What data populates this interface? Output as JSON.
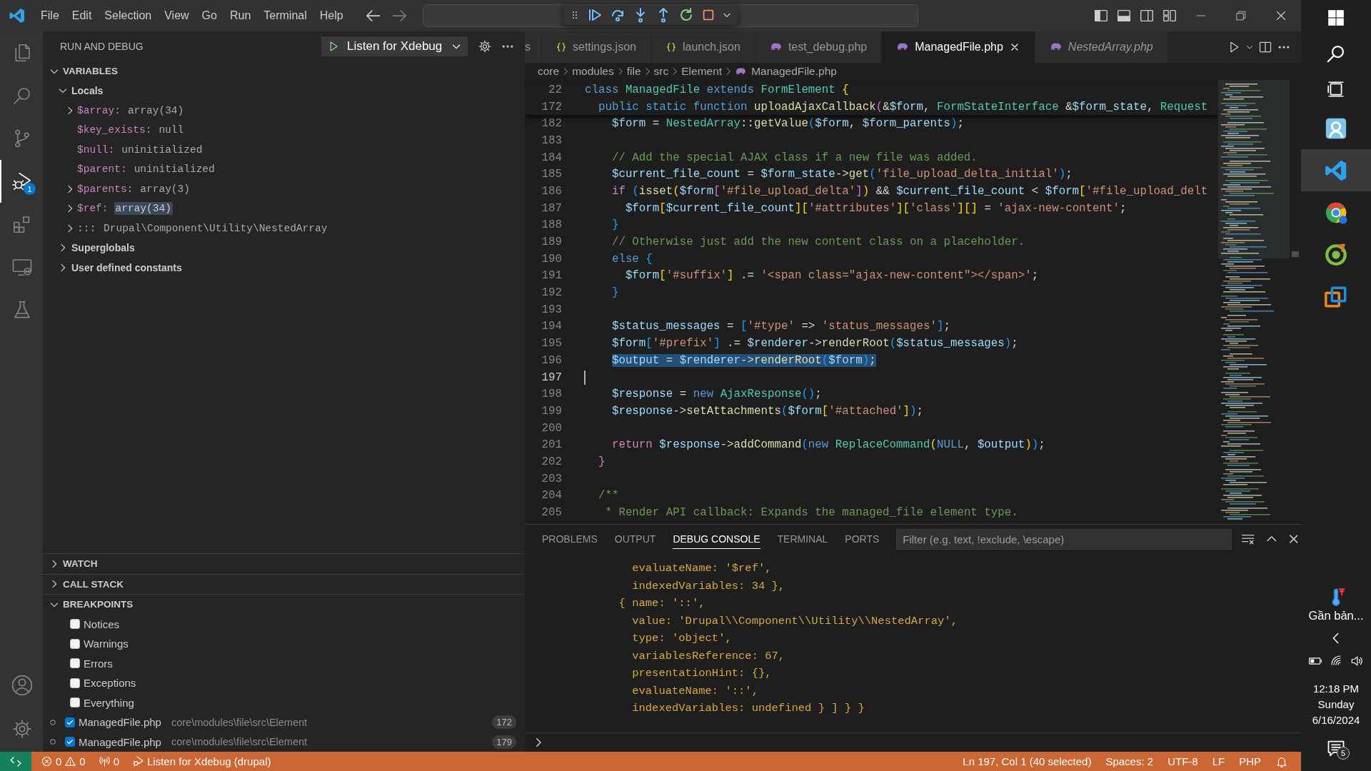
{
  "title_bar": {
    "menu": [
      "File",
      "Edit",
      "Selection",
      "View",
      "Go",
      "Run",
      "Terminal",
      "Help"
    ]
  },
  "activity_bar": {
    "items": [
      {
        "selected": false
      },
      {
        "selected": false
      },
      {
        "selected": false
      },
      {
        "selected": true,
        "badge": "1"
      },
      {
        "selected": false
      },
      {
        "selected": false
      },
      {
        "selected": false
      }
    ]
  },
  "sidebar": {
    "title": "RUN AND DEBUG",
    "config": "Listen for Xdebug",
    "variables": {
      "label": "VARIABLES",
      "expanded": true,
      "scopes": [
        {
          "label": "Locals",
          "expanded": true,
          "children": [
            {
              "name": "$array:",
              "value": "array(34)",
              "kind": "variable",
              "expandable": true,
              "highlighted": false
            },
            {
              "name": "$key_exists:",
              "value": "null",
              "kind": "variable",
              "expandable": false,
              "highlighted": false
            },
            {
              "name": "$null:",
              "value": "uninitialized",
              "kind": "variable",
              "expandable": false,
              "highlighted": false
            },
            {
              "name": "$parent:",
              "value": "uninitialized",
              "kind": "variable",
              "expandable": false,
              "highlighted": false
            },
            {
              "name": "$parents:",
              "value": "array(3)",
              "kind": "variable",
              "expandable": true,
              "highlighted": false
            },
            {
              "name": "$ref:",
              "value": "array(34)",
              "kind": "variable",
              "expandable": true,
              "highlighted": true
            },
            {
              "name": ":::",
              "value": "Drupal\\Component\\Utility\\NestedArray",
              "kind": "class",
              "expandable": true,
              "highlighted": false
            }
          ]
        },
        {
          "label": "Superglobals",
          "expanded": false
        },
        {
          "label": "User defined constants",
          "expanded": false
        }
      ]
    },
    "watch": {
      "label": "WATCH",
      "expanded": false
    },
    "call_stack": {
      "label": "CALL STACK",
      "expanded": false
    },
    "breakpoints": {
      "label": "BREAKPOINTS",
      "expanded": true,
      "items": [
        {
          "kind": "filter",
          "label": "Notices",
          "checked": false
        },
        {
          "kind": "filter",
          "label": "Warnings",
          "checked": false
        },
        {
          "kind": "filter",
          "label": "Errors",
          "checked": false
        },
        {
          "kind": "filter",
          "label": "Exceptions",
          "checked": false
        },
        {
          "kind": "filter",
          "label": "Everything",
          "checked": false
        },
        {
          "kind": "file",
          "label": "ManagedFile.php",
          "path": "core\\modules\\file\\src\\Element",
          "line": "172",
          "checked": true
        },
        {
          "kind": "file",
          "label": "ManagedFile.php",
          "path": "core\\modules\\file\\src\\Element",
          "line": "179",
          "checked": true
        }
      ]
    }
  },
  "editor": {
    "tabs": [
      {
        "label": "s",
        "selected": false,
        "preview": false
      },
      {
        "label": "settings.json",
        "kind": "json",
        "selected": false,
        "preview": false
      },
      {
        "label": "launch.json",
        "kind": "json",
        "selected": false,
        "preview": false
      },
      {
        "label": "test_debug.php",
        "kind": "php",
        "selected": false,
        "preview": false
      },
      {
        "label": "ManagedFile.php",
        "kind": "php",
        "selected": true,
        "preview": false
      },
      {
        "label": "NestedArray.php",
        "kind": "php",
        "selected": false,
        "preview": true
      }
    ],
    "breadcrumb": [
      "core",
      "modules",
      "file",
      "src",
      "Element",
      "ManagedFile.php"
    ],
    "sticky_lines": [
      {
        "number": "22",
        "tokens": [
          {
            "text": "class ",
            "kind": "keyword"
          },
          {
            "text": "ManagedFile ",
            "kind": "type"
          },
          {
            "text": "extends ",
            "kind": "keyword"
          },
          {
            "text": "FormElement ",
            "kind": "type"
          },
          {
            "text": "{",
            "kind": "bracket1"
          }
        ]
      },
      {
        "number": "172",
        "tokens": [
          {
            "text": "  public static function ",
            "kind": "keyword"
          },
          {
            "text": "uploadAjaxCallback",
            "kind": "function"
          },
          {
            "text": "(",
            "kind": "bracket2"
          },
          {
            "text": "&",
            "kind": "operator"
          },
          {
            "text": "$form",
            "kind": "variable"
          },
          {
            "text": ", ",
            "kind": "operator"
          },
          {
            "text": "FormStateInterface ",
            "kind": "type"
          },
          {
            "text": "&",
            "kind": "operator"
          },
          {
            "text": "$form_state",
            "kind": "variable"
          },
          {
            "text": ", ",
            "kind": "operator"
          },
          {
            "text": "Request",
            "kind": "type"
          }
        ]
      }
    ],
    "lines": [
      {
        "number": "182",
        "selected": false,
        "cursor": false,
        "tokens": [
          {
            "text": "    $form",
            "kind": "variable"
          },
          {
            "text": " = ",
            "kind": "operator"
          },
          {
            "text": "NestedArray",
            "kind": "type"
          },
          {
            "text": "::",
            "kind": "operator"
          },
          {
            "text": "getValue",
            "kind": "function"
          },
          {
            "text": "(",
            "kind": "bracket3"
          },
          {
            "text": "$form",
            "kind": "variable"
          },
          {
            "text": ", ",
            "kind": "operator"
          },
          {
            "text": "$form_parents",
            "kind": "variable"
          },
          {
            "text": ")",
            "kind": "bracket3"
          },
          {
            "text": ";",
            "kind": "operator"
          }
        ]
      },
      {
        "number": "183",
        "selected": false,
        "cursor": false
      },
      {
        "number": "184",
        "selected": false,
        "cursor": false,
        "tokens": [
          {
            "text": "    // Add the special AJAX class if a new file was added.",
            "kind": "comment"
          }
        ]
      },
      {
        "number": "185",
        "selected": false,
        "cursor": false,
        "tokens": [
          {
            "text": "    $current_file_count",
            "kind": "variable"
          },
          {
            "text": " = ",
            "kind": "operator"
          },
          {
            "text": "$form_state",
            "kind": "variable"
          },
          {
            "text": "->",
            "kind": "operator"
          },
          {
            "text": "get",
            "kind": "function"
          },
          {
            "text": "(",
            "kind": "bracket3"
          },
          {
            "text": "'file_upload_delta_initial'",
            "kind": "string"
          },
          {
            "text": ")",
            "kind": "bracket3"
          },
          {
            "text": ";",
            "kind": "operator"
          }
        ]
      },
      {
        "number": "186",
        "selected": false,
        "cursor": false,
        "tokens": [
          {
            "text": "    if ",
            "kind": "control"
          },
          {
            "text": "(",
            "kind": "bracket3"
          },
          {
            "text": "isset",
            "kind": "function"
          },
          {
            "text": "(",
            "kind": "bracket1"
          },
          {
            "text": "$form",
            "kind": "variable"
          },
          {
            "text": "[",
            "kind": "bracket2"
          },
          {
            "text": "'#file_upload_delta'",
            "kind": "string"
          },
          {
            "text": "]",
            "kind": "bracket2"
          },
          {
            "text": ")",
            "kind": "bracket1"
          },
          {
            "text": " && ",
            "kind": "operator"
          },
          {
            "text": "$current_file_count",
            "kind": "variable"
          },
          {
            "text": " < ",
            "kind": "operator"
          },
          {
            "text": "$form",
            "kind": "variable"
          },
          {
            "text": "[",
            "kind": "bracket1"
          },
          {
            "text": "'#file_upload_delt",
            "kind": "string"
          }
        ]
      },
      {
        "number": "187",
        "selected": false,
        "cursor": false,
        "tokens": [
          {
            "text": "      $form",
            "kind": "variable"
          },
          {
            "text": "[",
            "kind": "bracket1"
          },
          {
            "text": "$current_file_count",
            "kind": "variable"
          },
          {
            "text": "][",
            "kind": "bracket1"
          },
          {
            "text": "'#attributes'",
            "kind": "string"
          },
          {
            "text": "][",
            "kind": "bracket1"
          },
          {
            "text": "'class'",
            "kind": "string"
          },
          {
            "text": "][]",
            "kind": "bracket1"
          },
          {
            "text": " = ",
            "kind": "operator"
          },
          {
            "text": "'ajax-new-content'",
            "kind": "string"
          },
          {
            "text": ";",
            "kind": "operator"
          }
        ]
      },
      {
        "number": "188",
        "selected": false,
        "cursor": false,
        "tokens": [
          {
            "text": "    }",
            "kind": "bracket3"
          }
        ]
      },
      {
        "number": "189",
        "selected": false,
        "cursor": false,
        "tokens": [
          {
            "text": "    // Otherwise just add the new content class on a placeholder.",
            "kind": "comment"
          }
        ]
      },
      {
        "number": "190",
        "selected": false,
        "cursor": false,
        "tokens": [
          {
            "text": "    else ",
            "kind": "keyword"
          },
          {
            "text": "{",
            "kind": "bracket3"
          }
        ]
      },
      {
        "number": "191",
        "selected": false,
        "cursor": false,
        "tokens": [
          {
            "text": "      $form",
            "kind": "variable"
          },
          {
            "text": "[",
            "kind": "bracket1"
          },
          {
            "text": "'#suffix'",
            "kind": "string"
          },
          {
            "text": "]",
            "kind": "bracket1"
          },
          {
            "text": " .= ",
            "kind": "operator"
          },
          {
            "text": "'<span class=\"ajax-new-content\"></span>'",
            "kind": "string"
          },
          {
            "text": ";",
            "kind": "operator"
          }
        ]
      },
      {
        "number": "192",
        "selected": false,
        "cursor": false,
        "tokens": [
          {
            "text": "    }",
            "kind": "bracket3"
          }
        ]
      },
      {
        "number": "193",
        "selected": false,
        "cursor": false
      },
      {
        "number": "194",
        "selected": false,
        "cursor": false,
        "tokens": [
          {
            "text": "    $status_messages",
            "kind": "variable"
          },
          {
            "text": " = ",
            "kind": "operator"
          },
          {
            "text": "[",
            "kind": "bracket3"
          },
          {
            "text": "'#type'",
            "kind": "string"
          },
          {
            "text": " => ",
            "kind": "operator"
          },
          {
            "text": "'status_messages'",
            "kind": "string"
          },
          {
            "text": "]",
            "kind": "bracket3"
          },
          {
            "text": ";",
            "kind": "operator"
          }
        ]
      },
      {
        "number": "195",
        "selected": false,
        "cursor": false,
        "tokens": [
          {
            "text": "    $form",
            "kind": "variable"
          },
          {
            "text": "[",
            "kind": "bracket3"
          },
          {
            "text": "'#prefix'",
            "kind": "string"
          },
          {
            "text": "]",
            "kind": "bracket3"
          },
          {
            "text": " .= ",
            "kind": "operator"
          },
          {
            "text": "$renderer",
            "kind": "variable"
          },
          {
            "text": "->",
            "kind": "operator"
          },
          {
            "text": "renderRoot",
            "kind": "function"
          },
          {
            "text": "(",
            "kind": "bracket3"
          },
          {
            "text": "$status_messages",
            "kind": "variable"
          },
          {
            "text": ")",
            "kind": "bracket3"
          },
          {
            "text": ";",
            "kind": "operator"
          }
        ]
      },
      {
        "number": "196",
        "selected": true,
        "cursor": false,
        "tokens": [
          {
            "text": "    $output",
            "kind": "variable"
          },
          {
            "text": " = ",
            "kind": "operator"
          },
          {
            "text": "$renderer",
            "kind": "variable"
          },
          {
            "text": "->",
            "kind": "operator"
          },
          {
            "text": "renderRoot",
            "kind": "function"
          },
          {
            "text": "(",
            "kind": "bracket3"
          },
          {
            "text": "$form",
            "kind": "variable"
          },
          {
            "text": ")",
            "kind": "bracket3"
          },
          {
            "text": ";",
            "kind": "operator"
          }
        ]
      },
      {
        "number": "197",
        "selected": false,
        "cursor": true
      },
      {
        "number": "198",
        "selected": false,
        "cursor": false,
        "tokens": [
          {
            "text": "    $response",
            "kind": "variable"
          },
          {
            "text": " = ",
            "kind": "operator"
          },
          {
            "text": "new ",
            "kind": "keyword"
          },
          {
            "text": "AjaxResponse",
            "kind": "type"
          },
          {
            "text": "()",
            "kind": "bracket3"
          },
          {
            "text": ";",
            "kind": "operator"
          }
        ]
      },
      {
        "number": "199",
        "selected": false,
        "cursor": false,
        "tokens": [
          {
            "text": "    $response",
            "kind": "variable"
          },
          {
            "text": "->",
            "kind": "operator"
          },
          {
            "text": "setAttachments",
            "kind": "function"
          },
          {
            "text": "(",
            "kind": "bracket3"
          },
          {
            "text": "$form",
            "kind": "variable"
          },
          {
            "text": "[",
            "kind": "bracket1"
          },
          {
            "text": "'#attached'",
            "kind": "string"
          },
          {
            "text": "]",
            "kind": "bracket1"
          },
          {
            "text": ")",
            "kind": "bracket3"
          },
          {
            "text": ";",
            "kind": "operator"
          }
        ]
      },
      {
        "number": "200",
        "selected": false,
        "cursor": false
      },
      {
        "number": "201",
        "selected": false,
        "cursor": false,
        "tokens": [
          {
            "text": "    return ",
            "kind": "control"
          },
          {
            "text": "$response",
            "kind": "variable"
          },
          {
            "text": "->",
            "kind": "operator"
          },
          {
            "text": "addCommand",
            "kind": "function"
          },
          {
            "text": "(",
            "kind": "bracket3"
          },
          {
            "text": "new ",
            "kind": "keyword"
          },
          {
            "text": "ReplaceCommand",
            "kind": "type"
          },
          {
            "text": "(",
            "kind": "bracket1"
          },
          {
            "text": "NULL",
            "kind": "keyword"
          },
          {
            "text": ", ",
            "kind": "operator"
          },
          {
            "text": "$output",
            "kind": "variable"
          },
          {
            "text": ")",
            "kind": "bracket1"
          },
          {
            "text": ")",
            "kind": "bracket3"
          },
          {
            "text": ";",
            "kind": "operator"
          }
        ]
      },
      {
        "number": "202",
        "selected": false,
        "cursor": false,
        "tokens": [
          {
            "text": "  }",
            "kind": "bracket2"
          }
        ]
      },
      {
        "number": "203",
        "selected": false,
        "cursor": false
      },
      {
        "number": "204",
        "selected": false,
        "cursor": false,
        "tokens": [
          {
            "text": "  /**",
            "kind": "comment"
          }
        ]
      },
      {
        "number": "205",
        "selected": false,
        "cursor": false,
        "tokens": [
          {
            "text": "   * Render API callback: Expands the managed_file element type.",
            "kind": "comment"
          }
        ]
      }
    ]
  },
  "panel": {
    "tabs": [
      {
        "label": "PROBLEMS",
        "selected": false
      },
      {
        "label": "OUTPUT",
        "selected": false
      },
      {
        "label": "DEBUG CONSOLE",
        "selected": true
      },
      {
        "label": "TERMINAL",
        "selected": false
      },
      {
        "label": "PORTS",
        "selected": false
      }
    ],
    "filter_placeholder": "Filter (e.g. text, !exclude, \\escape)",
    "console_lines": [
      "    evaluateName: '$ref',",
      "    indexedVariables: 34 },",
      "  { name: '::',",
      "    value: 'Drupal\\\\Component\\\\Utility\\\\NestedArray',",
      "    type: 'object',",
      "    variablesReference: 67,",
      "    presentationHint: {},",
      "    evaluateName: '::',",
      "    indexedVariables: undefined } ] } }"
    ]
  },
  "status_bar": {
    "errors": "0",
    "warnings": "0",
    "ports": "0",
    "debug_session": "Listen for Xdebug (drupal)",
    "items": [
      "Ln 197, Col 1 (40 selected)",
      "Spaces: 2",
      "UTF-8",
      "LF",
      "PHP"
    ]
  },
  "taskbar": {
    "apps": [
      {
        "selected": false
      },
      {
        "selected": true
      },
      {
        "selected": false
      },
      {
        "selected": false
      },
      {
        "selected": false
      }
    ],
    "weather": "Gần bản...",
    "time": "12:18 PM",
    "day": "Sunday",
    "date": "6/16/2024",
    "notifications": "5"
  }
}
